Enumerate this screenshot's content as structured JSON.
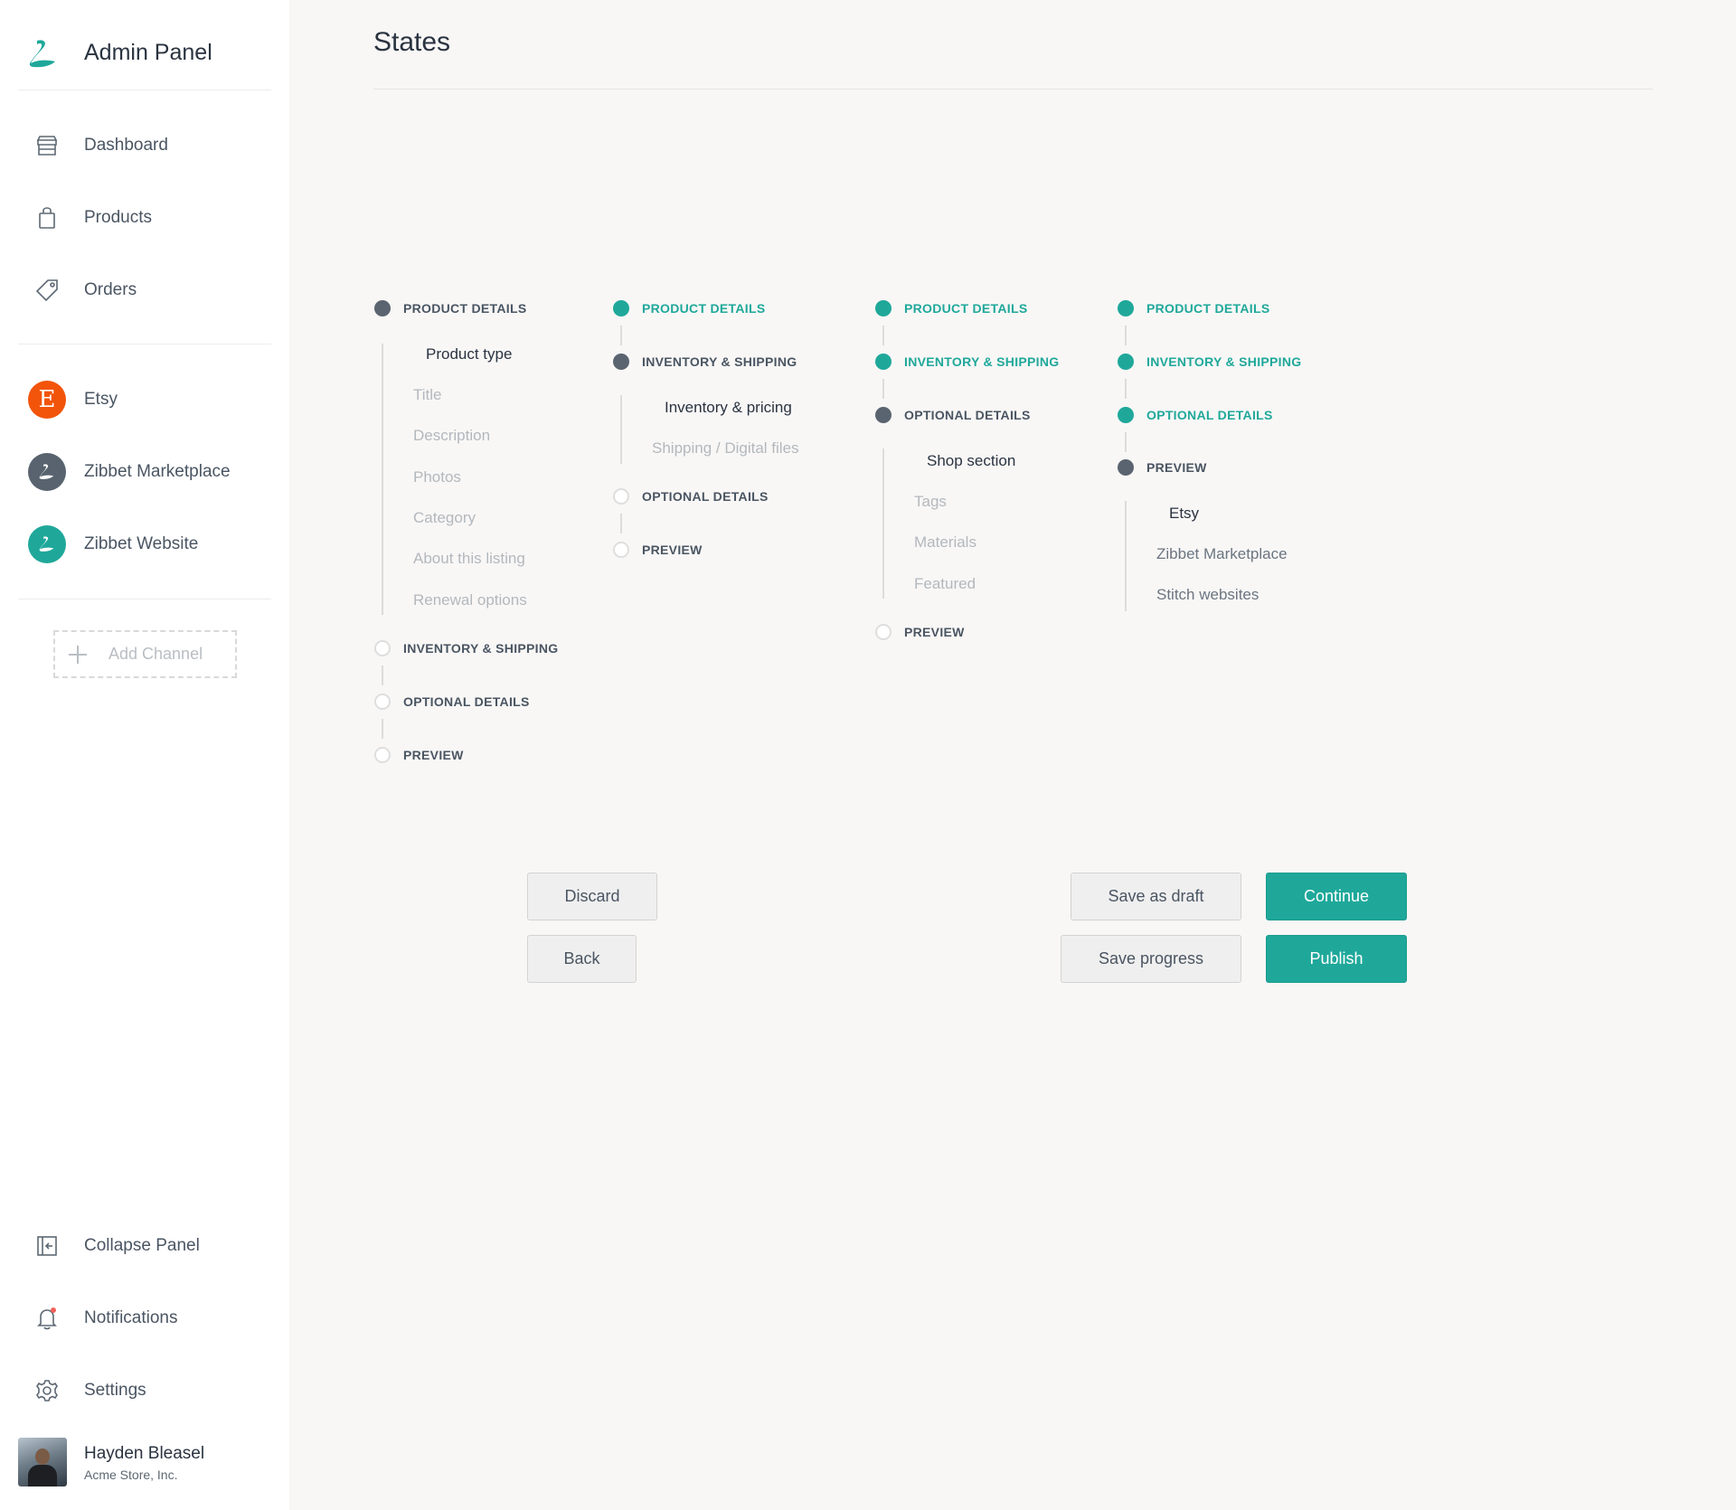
{
  "app": {
    "title": "Admin Panel"
  },
  "nav": {
    "dashboard": "Dashboard",
    "products": "Products",
    "orders": "Orders"
  },
  "channels": {
    "etsy": "Etsy",
    "etsy_letter": "E",
    "zibbet_marketplace": "Zibbet Marketplace",
    "zibbet_website": "Zibbet Website",
    "add_channel": "Add Channel"
  },
  "footer_nav": {
    "collapse": "Collapse Panel",
    "notifications": "Notifications",
    "settings": "Settings"
  },
  "user": {
    "name": "Hayden Bleasel",
    "org": "Acme Store, Inc."
  },
  "page": {
    "title": "States"
  },
  "steppers": [
    {
      "steps": [
        "PRODUCT DETAILS",
        "INVENTORY & SHIPPING",
        "OPTIONAL DETAILS",
        "PREVIEW"
      ],
      "substeps": [
        "Product type",
        "Title",
        "Description",
        "Photos",
        "Category",
        "About this listing",
        "Renewal options"
      ]
    },
    {
      "steps": [
        "PRODUCT DETAILS",
        "INVENTORY & SHIPPING",
        "OPTIONAL DETAILS",
        "PREVIEW"
      ],
      "substeps": [
        "Inventory & pricing",
        "Shipping / Digital files"
      ]
    },
    {
      "steps": [
        "PRODUCT DETAILS",
        "INVENTORY & SHIPPING",
        "OPTIONAL DETAILS",
        "PREVIEW"
      ],
      "substeps": [
        "Shop section",
        "Tags",
        "Materials",
        "Featured"
      ]
    },
    {
      "steps": [
        "PRODUCT DETAILS",
        "INVENTORY & SHIPPING",
        "OPTIONAL DETAILS",
        "PREVIEW"
      ],
      "substeps": [
        "Etsy",
        "Zibbet Marketplace",
        "Stitch websites"
      ]
    }
  ],
  "buttons": {
    "discard": "Discard",
    "back": "Back",
    "save_draft": "Save as draft",
    "save_progress": "Save progress",
    "continue": "Continue",
    "publish": "Publish"
  },
  "colors": {
    "accent": "#1fa89a",
    "active_step": "#5a6470",
    "etsy": "#f2540a",
    "notification_dot": "#f0625a"
  }
}
